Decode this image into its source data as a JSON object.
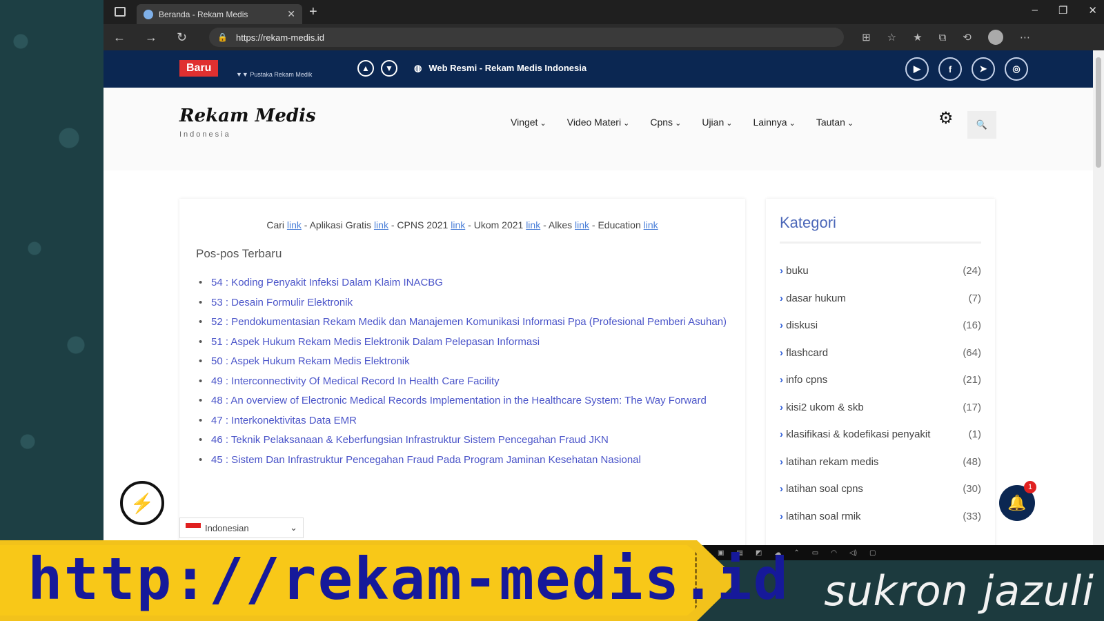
{
  "browser": {
    "tab_title": "Beranda - Rekam Medis",
    "url": "https://rekam-medis.id"
  },
  "topbar": {
    "badge": "Baru",
    "ticker": "▼▼ Pustaka Rekam Medik",
    "official": "Web Resmi - Rekam Medis Indonesia"
  },
  "site": {
    "logo": "Rekam Medis",
    "logo_sub": "Indonesia",
    "menu": [
      "Vinget",
      "Video Materi",
      "Cpns",
      "Ujian",
      "Lainnya",
      "Tautan"
    ]
  },
  "main": {
    "links_line": [
      {
        "label": "Cari",
        "link": "link"
      },
      {
        "label": "Aplikasi Gratis",
        "link": "link"
      },
      {
        "label": "CPNS 2021",
        "link": "link"
      },
      {
        "label": "Ukom 2021",
        "link": "link"
      },
      {
        "label": "Alkes",
        "link": "link"
      },
      {
        "label": "Education",
        "link": "link"
      }
    ],
    "section_title": "Pos-pos Terbaru",
    "posts": [
      "54 : Koding Penyakit Infeksi Dalam Klaim INACBG",
      "53 : Desain Formulir Elektronik",
      "52 : Pendokumentasian Rekam Medik dan Manajemen Komunikasi Informasi Ppa (Profesional Pemberi Asuhan)",
      "51 : Aspek Hukum Rekam Medis Elektronik Dalam Pelepasan Informasi",
      "50 : Aspek Hukum Rekam Medis Elektronik",
      "49 : Interconnectivity Of Medical Record In Health Care Facility",
      "48 : An overview of Electronic Medical Records Implementation in the Healthcare System: The Way Forward",
      "47 : Interkonektivitas Data EMR",
      "46 : Teknik Pelaksanaan & Keberfungsian Infrastruktur Sistem Pencegahan Fraud JKN",
      "45 : Sistem Dan Infrastruktur Pencegahan Fraud Pada Program Jaminan Kesehatan Nasional"
    ]
  },
  "sidebar": {
    "title": "Kategori",
    "items": [
      {
        "name": "buku",
        "count": "(24)"
      },
      {
        "name": "dasar hukum",
        "count": "(7)"
      },
      {
        "name": "diskusi",
        "count": "(16)"
      },
      {
        "name": "flashcard",
        "count": "(64)"
      },
      {
        "name": "info cpns",
        "count": "(21)"
      },
      {
        "name": "kisi2 ukom & skb",
        "count": "(17)"
      },
      {
        "name": "klasifikasi & kodefikasi penyakit",
        "count": "(1)"
      },
      {
        "name": "latihan rekam medis",
        "count": "(48)"
      },
      {
        "name": "latihan soal cpns",
        "count": "(30)"
      },
      {
        "name": "latihan soal rmik",
        "count": "(33)"
      }
    ]
  },
  "language": "Indonesian",
  "notification_count": "1",
  "overlay": {
    "banner_text": "http://rekam-medis.id",
    "signature": "sukron jazuli"
  }
}
